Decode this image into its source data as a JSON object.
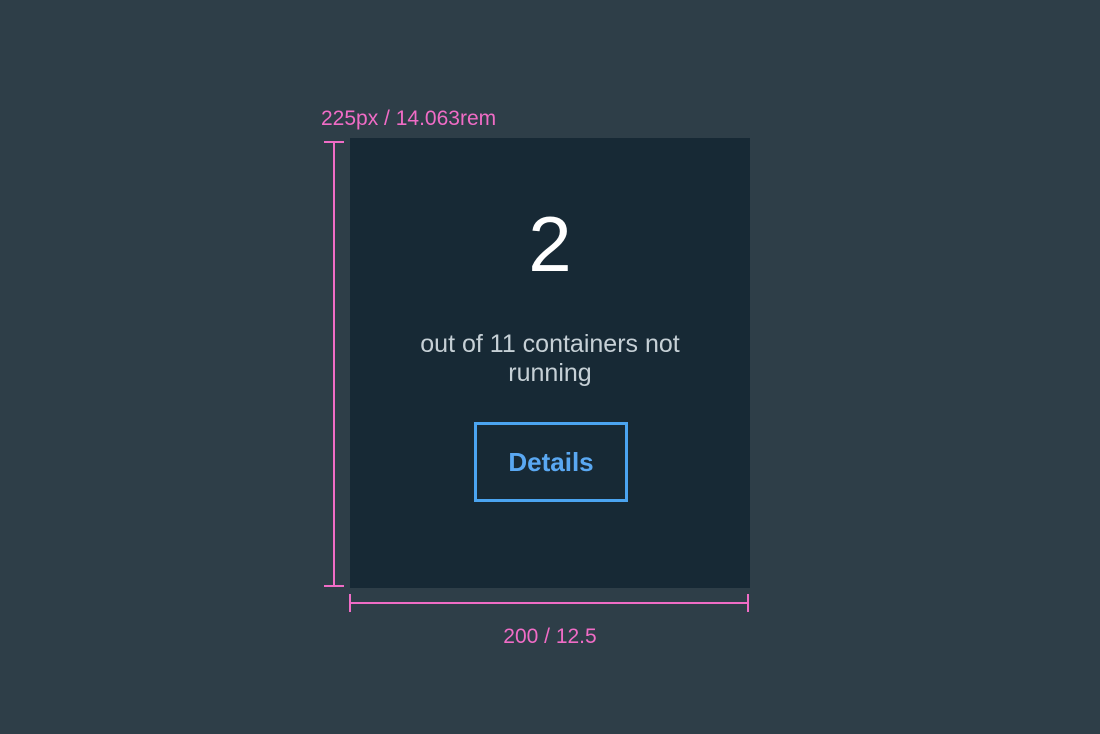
{
  "card": {
    "count": "2",
    "caption": "out of 11 containers not running",
    "button_label": "Details"
  },
  "annotations": {
    "height_label": "225px / 14.063rem",
    "width_label": "200 / 12.5"
  },
  "colors": {
    "page_background": "#2e3e48",
    "card_background": "#172935",
    "accent": "#4ba4f0",
    "annotation": "#f06cc6"
  }
}
